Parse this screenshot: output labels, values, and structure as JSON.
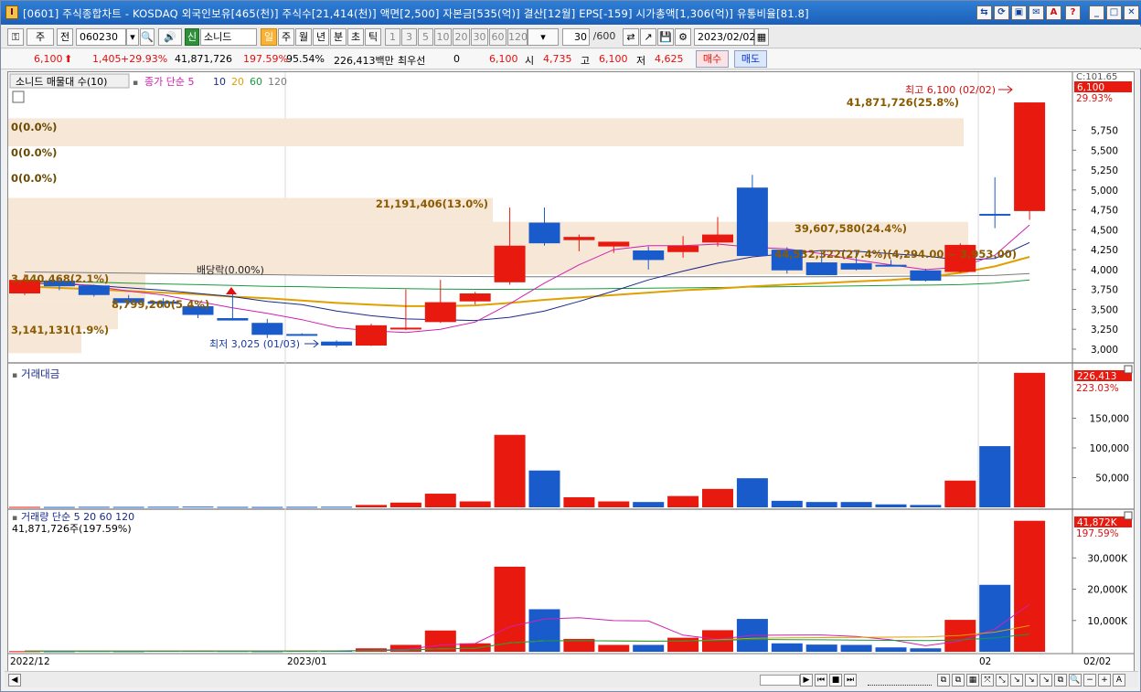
{
  "titlebar": {
    "title": "[0601] 주식종합차트 - KOSDAQ 외국인보유[465(천)] 주식수[21,414(천)] 액면[2,500] 자본금[535(억)] 결산[12월] EPS[-159] 시가총액[1,306(억)] 유통비율[81.8]",
    "app_icon": "I",
    "buttons": [
      "link-icon",
      "refresh-icon",
      "window-icon",
      "save-icon",
      "font-icon",
      "help-icon",
      "minimize-icon",
      "maximize-icon",
      "close-icon"
    ],
    "button_glyphs": [
      "⇆",
      "⟳",
      "▣",
      "✉",
      "A",
      "?",
      "_",
      "□",
      "✕"
    ]
  },
  "toolbar": {
    "period_select": "주",
    "prev_label": "전",
    "code": "060230",
    "stock_name": "소니드",
    "stock_tag": "신",
    "periods": [
      "일",
      "주",
      "월",
      "년",
      "분",
      "초",
      "틱"
    ],
    "active_period": "일",
    "intervals": [
      "1",
      "3",
      "5",
      "10",
      "20",
      "30",
      "60",
      "120"
    ],
    "count": "30",
    "count_total": "/600",
    "date": "2023/02/02"
  },
  "infobar": {
    "price": "6,100",
    "change": "1,405",
    "change_pct": "+29.93%",
    "volume": "41,871,726",
    "volume_ratio": "197.59%",
    "turnover_pct": "95.54%",
    "amount": "226,413백만",
    "priority_label": "최우선",
    "priority_value": "0",
    "price2": "6,100",
    "open_label": "시",
    "open": "4,735",
    "high_label": "고",
    "high": "6,100",
    "low_label": "저",
    "low": "4,625",
    "buy_label": "매수",
    "sell_label": "매도"
  },
  "colors": {
    "up": "#e8190f",
    "down": "#1a5bcc",
    "ma5": "#d020b0",
    "ma10": "#1b2a8c",
    "ma20": "#e0a000",
    "ma60": "#1a9a3a",
    "ma120": "#7a7a7a"
  },
  "chart_data": [
    {
      "type": "candlestick",
      "title": "소니드 매물대 수(10)",
      "legend": [
        "종가 단순 5",
        "10",
        "20",
        "60",
        "120"
      ],
      "y_ticks": [
        "5,750",
        "5,500",
        "5,250",
        "5,000",
        "4,750",
        "4,500",
        "4,250",
        "4,000",
        "3,750",
        "3,500",
        "3,250",
        "3,000"
      ],
      "ylim": [
        2850,
        6250
      ],
      "current_price_label": "6,100",
      "current_pct_label": "29.93%",
      "top_label": "C:101.65",
      "candles": [
        {
          "o": 3700,
          "h": 3940,
          "l": 3680,
          "c": 3870
        },
        {
          "o": 3860,
          "h": 3900,
          "l": 3740,
          "c": 3790
        },
        {
          "o": 3800,
          "h": 3810,
          "l": 3660,
          "c": 3680
        },
        {
          "o": 3640,
          "h": 3680,
          "l": 3560,
          "c": 3580
        },
        {
          "o": 3600,
          "h": 3640,
          "l": 3520,
          "c": 3570
        },
        {
          "o": 3540,
          "h": 3560,
          "l": 3390,
          "c": 3430
        },
        {
          "o": 3390,
          "h": 3720,
          "l": 3360,
          "c": 3360
        },
        {
          "o": 3330,
          "h": 3380,
          "l": 3140,
          "c": 3180
        },
        {
          "o": 3190,
          "h": 3200,
          "l": 3170,
          "c": 3175
        },
        {
          "o": 3095,
          "h": 3110,
          "l": 3025,
          "c": 3045
        },
        {
          "o": 3045,
          "h": 3320,
          "l": 3040,
          "c": 3300
        },
        {
          "o": 3260,
          "h": 3750,
          "l": 3240,
          "c": 3270
        },
        {
          "o": 3340,
          "h": 3870,
          "l": 3330,
          "c": 3590
        },
        {
          "o": 3600,
          "h": 3720,
          "l": 3560,
          "c": 3700
        },
        {
          "o": 3840,
          "h": 4780,
          "l": 3810,
          "c": 4300
        },
        {
          "o": 4590,
          "h": 4780,
          "l": 4300,
          "c": 4330
        },
        {
          "o": 4370,
          "h": 4440,
          "l": 4230,
          "c": 4410
        },
        {
          "o": 4290,
          "h": 4350,
          "l": 4210,
          "c": 4350
        },
        {
          "o": 4240,
          "h": 4290,
          "l": 4000,
          "c": 4120
        },
        {
          "o": 4220,
          "h": 4420,
          "l": 4150,
          "c": 4300
        },
        {
          "o": 4340,
          "h": 4660,
          "l": 4290,
          "c": 4440
        },
        {
          "o": 5030,
          "h": 5190,
          "l": 4180,
          "c": 4170
        },
        {
          "o": 4250,
          "h": 4280,
          "l": 3950,
          "c": 3990
        },
        {
          "o": 4090,
          "h": 4240,
          "l": 3950,
          "c": 3930
        },
        {
          "o": 4080,
          "h": 4230,
          "l": 3990,
          "c": 4000
        },
        {
          "o": 4060,
          "h": 4120,
          "l": 4040,
          "c": 4050
        },
        {
          "o": 3990,
          "h": 4010,
          "l": 3850,
          "c": 3860
        },
        {
          "o": 3970,
          "h": 4330,
          "l": 3960,
          "c": 4310
        },
        {
          "o": 4700,
          "h": 5160,
          "l": 4520,
          "c": 4690
        },
        {
          "o": 4735,
          "h": 6100,
          "l": 4625,
          "c": 6100
        }
      ],
      "ma5": [
        3850,
        3840,
        3790,
        3730,
        3680,
        3600,
        3520,
        3450,
        3370,
        3270,
        3230,
        3210,
        3250,
        3340,
        3570,
        3830,
        4060,
        4250,
        4300,
        4300,
        4320,
        4280,
        4260,
        4200,
        4120,
        4060,
        4000,
        4030,
        4180,
        4560
      ],
      "ma10": [
        3830,
        3820,
        3800,
        3770,
        3740,
        3700,
        3660,
        3600,
        3560,
        3480,
        3420,
        3380,
        3370,
        3360,
        3400,
        3480,
        3600,
        3730,
        3870,
        3980,
        4080,
        4160,
        4200,
        4240,
        4230,
        4200,
        4170,
        4120,
        4140,
        4340
      ],
      "ma20": [
        3790,
        3770,
        3750,
        3730,
        3710,
        3690,
        3660,
        3640,
        3610,
        3580,
        3560,
        3540,
        3540,
        3550,
        3580,
        3620,
        3650,
        3680,
        3710,
        3740,
        3760,
        3790,
        3810,
        3830,
        3850,
        3870,
        3900,
        3960,
        4040,
        4160
      ],
      "ma60": [
        3860,
        3850,
        3840,
        3830,
        3820,
        3810,
        3800,
        3790,
        3785,
        3775,
        3768,
        3760,
        3755,
        3752,
        3752,
        3755,
        3758,
        3762,
        3766,
        3770,
        3775,
        3780,
        3785,
        3790,
        3795,
        3800,
        3805,
        3810,
        3830,
        3870
      ],
      "ma120": [
        3970,
        3965,
        3960,
        3955,
        3950,
        3945,
        3940,
        3935,
        3930,
        3925,
        3920,
        3918,
        3915,
        3912,
        3910,
        3910,
        3910,
        3910,
        3910,
        3910,
        3910,
        3910,
        3910,
        3910,
        3912,
        3915,
        3918,
        3922,
        3928,
        3950
      ],
      "annotations": {
        "volume_profile": [
          "41,871,726(25.8%)",
          "0(0.0%)",
          "0(0.0%)",
          "0(0.0%)",
          "21,191,406(13.0%)",
          "39,607,580(24.4%)",
          "44,532,322(27.4%)(4,294.00 ~ 3,953.00)",
          "3,440,468(2.1%)",
          "8,799,260(5.4%)",
          "3,141,131(1.9%)"
        ],
        "high_label": "최고 6,100 (02/02)",
        "low_label": "최저 3,025 (01/03)",
        "dividend_label": "배당락(0.00%)"
      }
    },
    {
      "type": "bar",
      "title": "거래대금",
      "y_ticks": [
        "150,000",
        "100,000",
        "50,000"
      ],
      "ylim": [
        0,
        240000
      ],
      "current_label": "226,413",
      "current_pct_label": "223.03%",
      "values": [
        1500,
        800,
        700,
        900,
        800,
        1000,
        1200,
        800,
        700,
        900,
        1000,
        4000,
        8000,
        23000,
        10000,
        122000,
        62000,
        17000,
        10000,
        9000,
        19000,
        31000,
        49000,
        11000,
        9000,
        9000,
        5000,
        4000,
        45000,
        103000,
        226413
      ]
    },
    {
      "type": "bar",
      "title": "거래량 단순 5 20 60 120",
      "subtitle": "41,871,726주(197.59%)",
      "y_ticks": [
        "30,000K",
        "20,000K",
        "10,000K"
      ],
      "ylim": [
        0,
        45000000
      ],
      "current_label": "41,872K",
      "current_pct_label": "197.59%",
      "x_labels": [
        "2022/12",
        "2023/01",
        "02",
        "02/02"
      ],
      "values": [
        400000,
        200000,
        180000,
        250000,
        200000,
        300000,
        350000,
        250000,
        200000,
        300000,
        300000,
        1100000,
        2200000,
        6800000,
        2700000,
        27200000,
        13600000,
        4100000,
        2200000,
        2200000,
        4500000,
        6900000,
        10500000,
        2700000,
        2300000,
        2200000,
        1400000,
        1100000,
        10200000,
        21400000,
        41871726
      ]
    }
  ]
}
